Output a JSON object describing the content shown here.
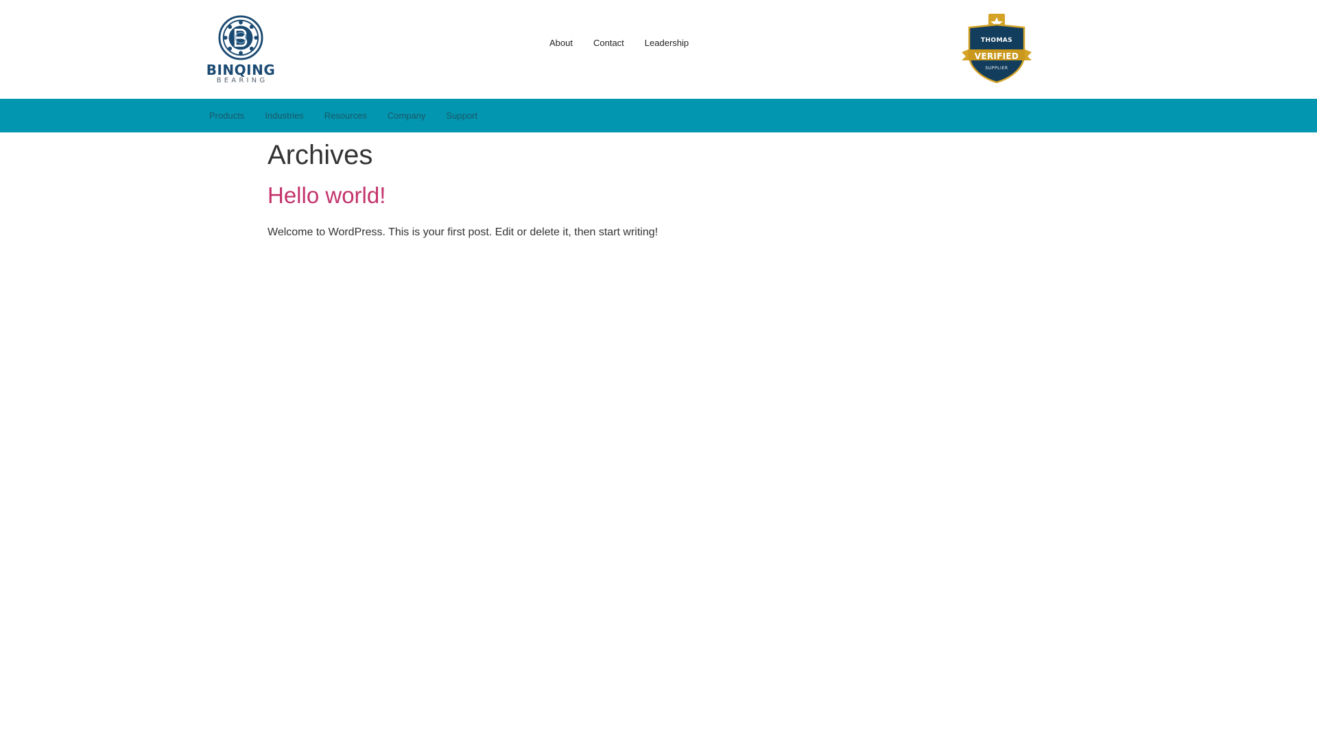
{
  "header": {
    "logo": {
      "name": "BINQING",
      "subtitle": "BEARING"
    },
    "top_nav": [
      {
        "label": "About"
      },
      {
        "label": "Contact"
      },
      {
        "label": "Leadership"
      }
    ],
    "badge": {
      "brand": "THOMAS",
      "status": "VERIFIED",
      "type": "SUPPLIER"
    }
  },
  "main_nav": [
    {
      "label": "Products"
    },
    {
      "label": "Industries"
    },
    {
      "label": "Resources"
    },
    {
      "label": "Company"
    },
    {
      "label": "Support"
    }
  ],
  "archive": {
    "title": "Archives",
    "posts": [
      {
        "title": "Hello world!",
        "excerpt": "Welcome to WordPress. This is your first post. Edit or delete it, then start writing!"
      }
    ]
  },
  "colors": {
    "nav_background": "#0396b0",
    "nav_text": "#1a5868",
    "post_link": "#c3336b",
    "logo_blue": "#1b4a72",
    "badge_gold": "#d4a326",
    "badge_navy": "#123d5c"
  }
}
